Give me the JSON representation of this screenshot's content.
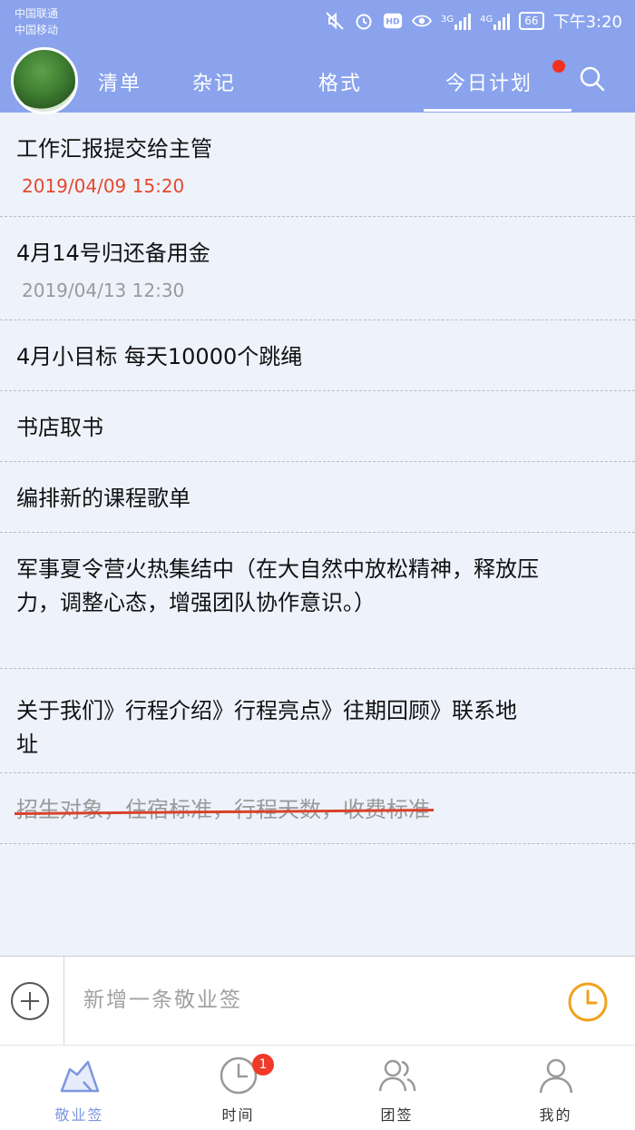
{
  "status_bar": {
    "carrier1": "中国联通",
    "carrier2": "中国移动",
    "network1": "3G",
    "network2": "4G",
    "battery": "66",
    "time": "下午3:20"
  },
  "nav": {
    "tabs": [
      "清单",
      "杂记",
      "格式",
      "今日计划"
    ],
    "active_tab_index": 3
  },
  "items": [
    {
      "title": "工作汇报提交给主管",
      "date": "2019/04/09  15:20",
      "urgent": true
    },
    {
      "title": "4月14号归还备用金",
      "date": "2019/04/13  12:30",
      "urgent": false
    },
    {
      "title": "4月小目标  每天10000个跳绳"
    },
    {
      "title": "书店取书"
    },
    {
      "title": "编排新的课程歌单"
    },
    {
      "title": "军事夏令营火热集结中（在大自然中放松精神，释放压力，调整心态，增强团队协作意识。）"
    },
    {
      "title": "关于我们》行程介绍》行程亮点》往期回顾》联系地址"
    },
    {
      "title": "招生对象，住宿标准，行程天数，收费标准",
      "completed": true
    }
  ],
  "compose": {
    "placeholder": "新增一条敬业签"
  },
  "bottom_nav": {
    "items": [
      "敬业签",
      "时间",
      "团签",
      "我的"
    ],
    "time_badge": "1"
  },
  "colors": {
    "header": "#8aa3ec",
    "urgent": "#e4492d",
    "accent_orange": "#f0a21c",
    "active_nav": "#7d97de"
  }
}
